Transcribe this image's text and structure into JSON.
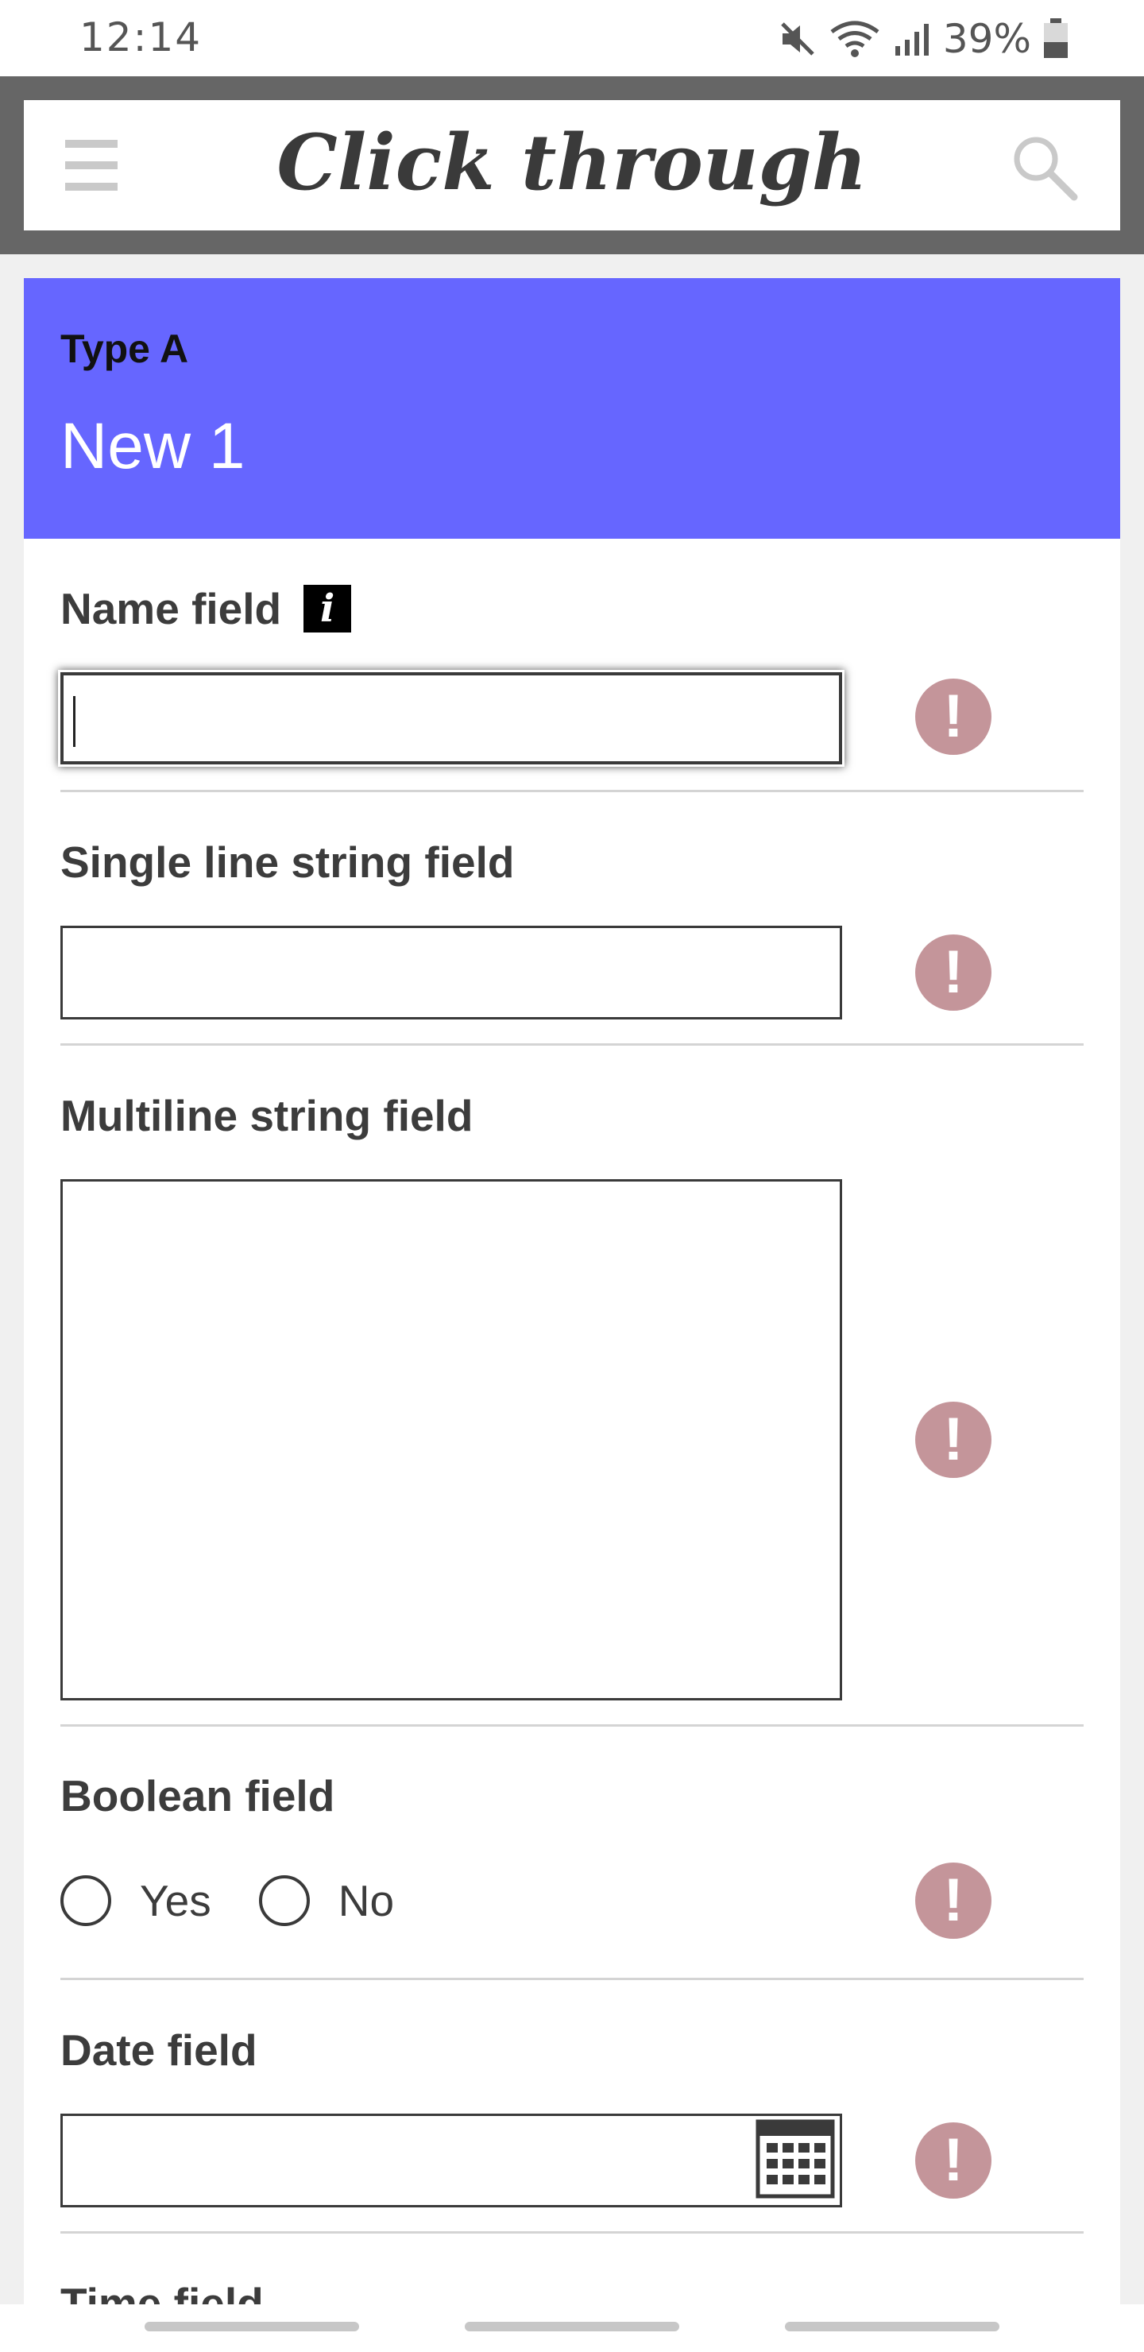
{
  "status_bar": {
    "time": "12:14",
    "battery": "39%"
  },
  "header": {
    "title": "Click through"
  },
  "record": {
    "type_label": "Type A",
    "name": "New 1"
  },
  "fields": {
    "name": {
      "label": "Name field",
      "value": ""
    },
    "single_line": {
      "label": "Single line string field",
      "value": ""
    },
    "multiline": {
      "label": "Multiline string field",
      "value": ""
    },
    "boolean": {
      "label": "Boolean field",
      "yes_label": "Yes",
      "no_label": "No"
    },
    "date": {
      "label": "Date field",
      "value": ""
    },
    "time": {
      "label": "Time field"
    }
  },
  "icons": {
    "alert": "!",
    "info": "i"
  },
  "colors": {
    "header_frame": "#666666",
    "card_header": "#6666ff",
    "alert": "#c4959a"
  }
}
